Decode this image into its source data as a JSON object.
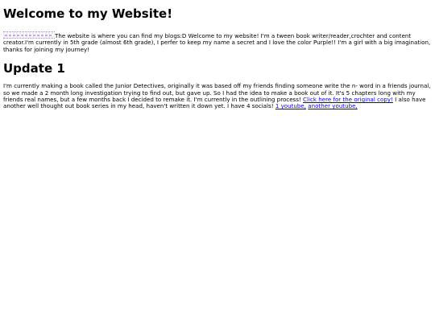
{
  "page": {
    "title": "Welcome to my Website!",
    "intro_text": "The website is where you can find my blogs:D Welcome to my website! I'm a tween book writer/reader,crochter and content creator.I'm currently in 5th grade (almost 6th grade), I perfer to keep my name a secret and I love the color Purple!! I'm a girl with a big imagination, thanks for joining my journey!",
    "banner_icon": "purple-banner-image"
  },
  "update": {
    "heading": "Update 1",
    "body_text": "I'm currently making a book called the Junior Detectives, originally it was based off my friends finding someone write the n- word in a friends journal, so we made a 2 month long investigation trying to find out, but gave up. So I had the idea to make a book out of it. It's 5 chapters long with my friends real names, but a few months back I decided to remake it. I'm currently in the outlining process! ",
    "link_original": "Click here for the original copy!",
    "after_link_text": " I also have another well thought out book series in my head, haven't written it down yet. I have 4 socials! ",
    "link_youtube_1": "1 youtube,",
    "link_youtube_2": "another youtube,"
  },
  "colors": {
    "link": "#0000ee",
    "banner_accent": "#c9a6e8"
  }
}
